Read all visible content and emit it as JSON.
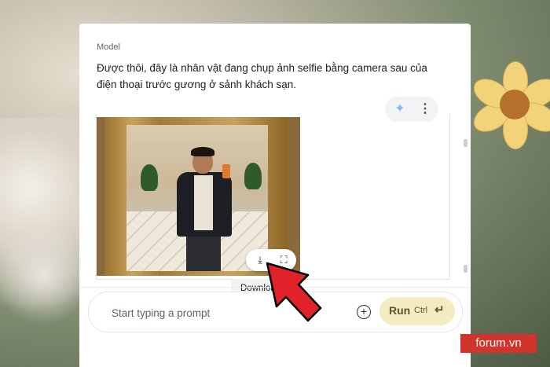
{
  "model_turn": {
    "label": "Model",
    "text": "Được thôi, đây là nhân vật đang chụp ảnh selfie bằng camera sau của điện thoại trước gương ở sảnh khách sạn."
  },
  "image_actions": {
    "download_icon": "download-icon",
    "fullscreen_icon": "fullscreen-icon",
    "tooltip": "Download"
  },
  "toolbar": {
    "spark_icon": "sparkle-icon",
    "more_icon": "more-vert-icon"
  },
  "prompt": {
    "placeholder": "Start typing a prompt",
    "add_icon": "add-circle-icon",
    "run_label": "Run",
    "run_shortcut": "Ctrl",
    "enter_icon": "enter-icon"
  },
  "colors": {
    "run_button_bg": "#f4ecc0",
    "arrow": "#e0232a",
    "watermark_bg": "#d0342c"
  },
  "watermark": "forum.vn"
}
